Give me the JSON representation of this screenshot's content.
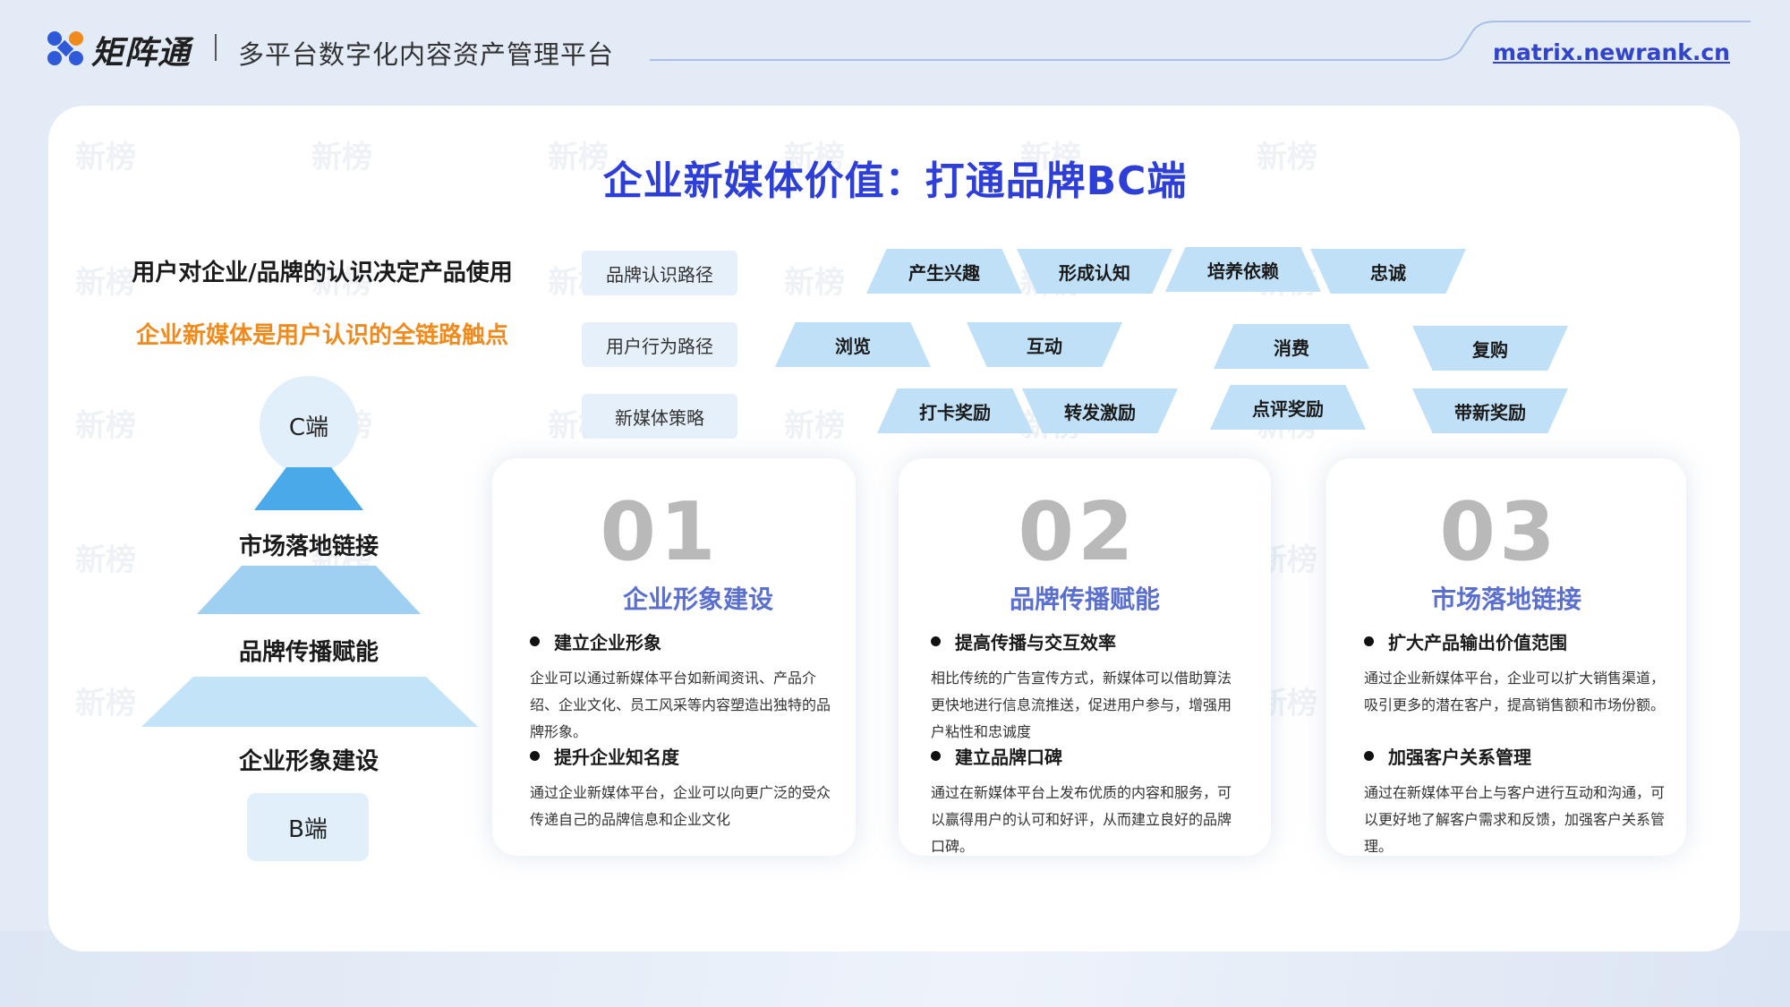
{
  "header": {
    "logo_text": "矩阵通",
    "subtitle": "多平台数字化内容资产管理平台",
    "url": "matrix.newrank.cn"
  },
  "watermark_text": "新榜",
  "main_title": "企业新媒体价值：打通品牌BC端",
  "left": {
    "heading1": "用户对企业/品牌的认识决定产品使用",
    "heading2": "企业新媒体是用户认识的全链路触点",
    "top_label": "C端",
    "tiers": [
      "市场落地链接",
      "品牌传播赋能",
      "企业形象建设"
    ],
    "bottom_label": "B端"
  },
  "rows": [
    {
      "label": "品牌认识路径",
      "tags": [
        "产生兴趣",
        "形成认知",
        "培养依赖",
        "忠诚"
      ]
    },
    {
      "label": "用户行为路径",
      "tags": [
        "浏览",
        "互动",
        "消费",
        "复购"
      ]
    },
    {
      "label": "新媒体策略",
      "tags": [
        "打卡奖励",
        "转发激励",
        "点评奖励",
        "带新奖励"
      ]
    }
  ],
  "cards": [
    {
      "number": "01",
      "title": "企业形象建设",
      "sections": [
        {
          "head": "建立企业形象",
          "body": "企业可以通过新媒体平台如新闻资讯、产品介绍、企业文化、员工风采等内容塑造出独特的品牌形象。"
        },
        {
          "head": "提升企业知名度",
          "body": "通过企业新媒体平台，企业可以向更广泛的受众传递自己的品牌信息和企业文化"
        }
      ]
    },
    {
      "number": "02",
      "title": "品牌传播赋能",
      "sections": [
        {
          "head": "提高传播与交互效率",
          "body": "相比传统的广告宣传方式，新媒体可以借助算法更快地进行信息流推送，促进用户参与，增强用户粘性和忠诚度"
        },
        {
          "head": "建立品牌口碑",
          "body": "通过在新媒体平台上发布优质的内容和服务，可以赢得用户的认可和好评，从而建立良好的品牌口碑。"
        }
      ]
    },
    {
      "number": "03",
      "title": "市场落地链接",
      "sections": [
        {
          "head": "扩大产品输出价值范围",
          "body": "通过企业新媒体平台，企业可以扩大销售渠道，吸引更多的潜在客户，提高销售额和市场份额。"
        },
        {
          "head": "加强客户关系管理",
          "body": "通过在新媒体平台上与客户进行互动和沟通，可以更好地了解客户需求和反馈，加强客户关系管理。"
        }
      ]
    }
  ],
  "colors": {
    "title_blue": "#2e3fd8",
    "accent_orange": "#f08a1c",
    "tag_blue": "#bfe0f6",
    "card_title": "#5b6fcf",
    "link_blue": "#3344cc"
  }
}
